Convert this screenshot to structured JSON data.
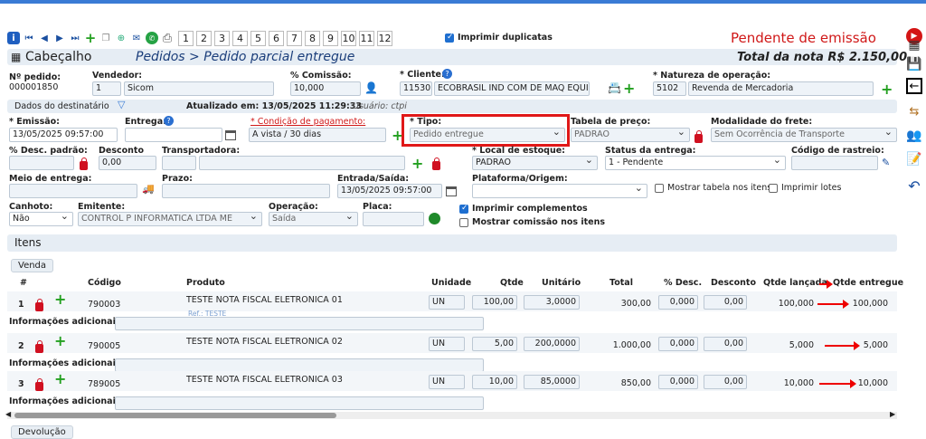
{
  "toolbar": {
    "pages": [
      "1",
      "2",
      "3",
      "4",
      "5",
      "6",
      "7",
      "8",
      "9",
      "10",
      "11",
      "12"
    ],
    "print_dup_label": "Imprimir duplicatas"
  },
  "status": {
    "text": "Pendente de emissão",
    "color": "#d01818"
  },
  "header": {
    "title": "Cabeçalho",
    "breadcrumb": "Pedidos > Pedido parcial entregue",
    "total": "Total da nota R$ 2.150,00"
  },
  "order": {
    "num_label": "Nº pedido:",
    "num": "000001850",
    "seller_label": "Vendedor:",
    "seller_code": "1",
    "seller_name": "Sicom",
    "commission_label": "% Comissão:",
    "commission": "10,000",
    "client_label": "* Cliente:",
    "client_code": "11530",
    "client_name": "ECOBRASIL IND COM DE MAQ EQUIP L",
    "nature_label": "* Natureza de operação:",
    "nature_code": "5102",
    "nature_name": "Revenda de Mercadoria"
  },
  "recipient": {
    "label": "Dados do destinatário",
    "updated": "Atualizado em: 13/05/2025 11:29:33",
    "user": "Usuário: ctpi"
  },
  "fields": {
    "emission_label": "* Emissão:",
    "emission": "13/05/2025 09:57:00",
    "delivery_label": "Entrega:",
    "payment_label": "* Condição de pagamento:",
    "payment": "A vista / 30 dias",
    "type_label": "* Tipo:",
    "type": "Pedido entregue",
    "price_table_label": "Tabela de preço:",
    "price_table": "PADRAO",
    "freight_label": "Modalidade do frete:",
    "freight": "Sem Ocorrência de Transporte",
    "disc_label": "% Desc. padrão:",
    "discount_label": "Desconto",
    "discount": "0,00",
    "carrier_label": "Transportadora:",
    "stock_label": "* Local de estoque:",
    "stock": "PADRAO",
    "delivery_status_label": "Status da entrega:",
    "delivery_status": "1 - Pendente",
    "tracking_label": "Código de rastreio:",
    "delivery_means_label": "Meio de entrega:",
    "term_label": "Prazo:",
    "inout_label": "Entrada/Saída:",
    "inout": "13/05/2025 09:57:00",
    "platform_label": "Plataforma/Origem:",
    "show_table_label": "Mostrar tabela nos itens",
    "print_lots_label": "Imprimir lotes",
    "stub_label": "Canhoto:",
    "stub": "Não",
    "issuer_label": "Emitente:",
    "issuer": "CONTROL P INFORMATICA LTDA ME",
    "operation_label": "Operação:",
    "operation": "Saída",
    "plate_label": "Placa:",
    "print_compl_label": "Imprimir complementos",
    "show_comm_label": "Mostrar comissão nos itens"
  },
  "items": {
    "title": "Itens",
    "tab": "Venda",
    "columns": [
      "#",
      "Código",
      "Produto",
      "Unidade",
      "Qtde",
      "Unitário",
      "Total",
      "% Desc.",
      "Desconto",
      "Qtde lançada",
      "Qtde entregue"
    ],
    "info_label": "Informações adicionais:",
    "ref": "Ref.: TESTE",
    "rows": [
      {
        "n": "1",
        "code": "790003",
        "product": "TESTE NOTA FISCAL ELETRONICA 01",
        "unit": "UN",
        "qty": "100,00",
        "unit_price": "3,0000",
        "total": "300,00",
        "disc_pct": "0,000",
        "disc": "0,00",
        "launched": "100,000",
        "delivered": "100,000"
      },
      {
        "n": "2",
        "code": "790005",
        "product": "TESTE NOTA FISCAL ELETRONICA 02",
        "unit": "UN",
        "qty": "5,00",
        "unit_price": "200,0000",
        "total": "1.000,00",
        "disc_pct": "0,000",
        "disc": "0,00",
        "launched": "5,000",
        "delivered": "5,000"
      },
      {
        "n": "3",
        "code": "789005",
        "product": "TESTE NOTA FISCAL ELETRONICA 03",
        "unit": "UN",
        "qty": "10,00",
        "unit_price": "85,0000",
        "total": "850,00",
        "disc_pct": "0,000",
        "disc": "0,00",
        "launched": "10,000",
        "delivered": "10,000"
      }
    ]
  },
  "returns": {
    "label": "Devolução"
  }
}
